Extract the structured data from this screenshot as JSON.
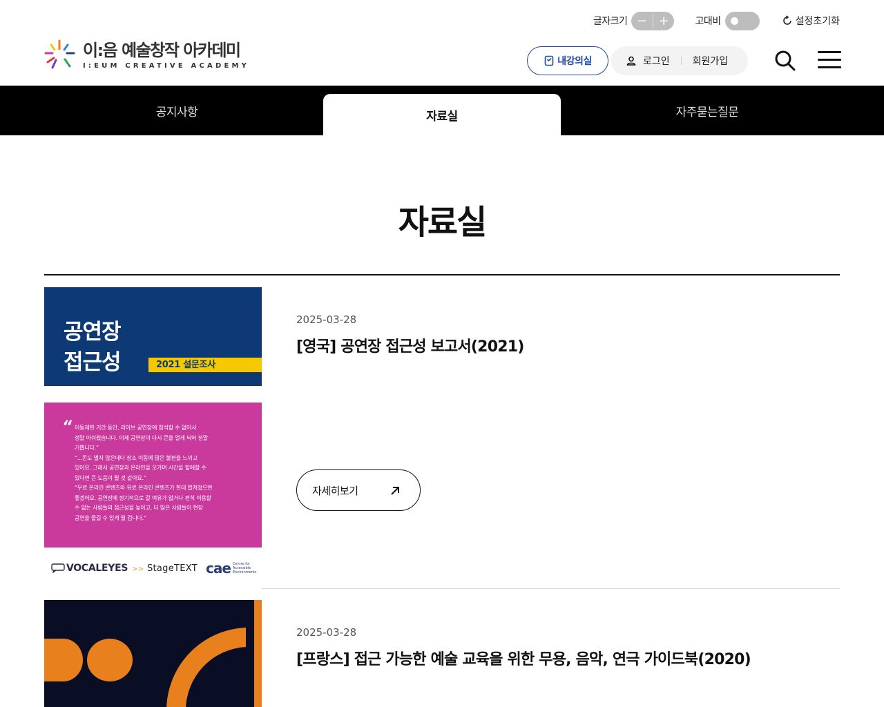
{
  "utility": {
    "font_size_label": "글자크기",
    "font_minus": "−",
    "font_plus": "+",
    "contrast_label": "고대비",
    "reset_label": "설정초기화"
  },
  "header": {
    "logo_ko": "이:음 예술창작 아카데미",
    "logo_en": "I:EUM CREATIVE ACADEMY",
    "my_class_label": "내강의실",
    "login_label": "로그인",
    "join_label": "회원가입"
  },
  "tabs": [
    {
      "label": "공지사항",
      "active": false
    },
    {
      "label": "자료실",
      "active": true
    },
    {
      "label": "자주묻는질문",
      "active": false
    }
  ],
  "page_title": "자료실",
  "items": [
    {
      "date": "2025-03-28",
      "title": "[영국] 공연장 접근성 보고서(2021)",
      "more_label": "자세히보기",
      "thumb": {
        "line1": "공연장",
        "line2": "접근성",
        "band": "2021 설문조사",
        "quote_mark": "“",
        "quote_lines": [
          "이동제한 기간 동안, 라이브 공연장에 참석할 수 없어서",
          "정말 아쉬웠습니다. 이제 공연장이 다시 문을 열게 되어 정말",
          "기쁩니다.”",
          "“...돈도 별지 않은데다 장소 이동에 많은 불편을 느끼고",
          "있어요. 그래서 공연장과 온라인을 오가며 시간을 할애할 수",
          "있다면 큰 도움이 될 것 같아요.”",
          "“무료 온라인 콘텐츠와 유료 온라인 콘텐츠가 한데 합쳐졌으면",
          "좋겠어요. 공연장에 정기적으로 갈 여유가 없거나 편히 이용할",
          "수 없는 사람들의 접근성을 높이고, 더 많은 사람들이 현장",
          "공연을 즐길 수 있게 될 겁니다.”"
        ],
        "logo_vocaleyes": "VOCALEYES",
        "logo_stagetext": "StageTEXT",
        "logo_stagetext_arrows": ">>",
        "logo_cae": "cae",
        "logo_cae_sub": "Centre for Accessible Environments"
      }
    },
    {
      "date": "2025-03-28",
      "title": "[프랑스] 접근 가능한 예술 교육을 위한 무용, 음악, 연극 가이드북(2020)"
    }
  ],
  "colors": {
    "tab_bar": "#000000",
    "accent_blue": "#1f4aa3",
    "cover_navy": "#0d3a74",
    "cover_yellow": "#f6c800",
    "cover_magenta": "#c93a9c",
    "cover2_orange": "#e8801e"
  },
  "icons": {
    "reset": "refresh-icon",
    "my_class": "book-icon",
    "login": "user-icon",
    "search": "search-icon",
    "menu": "hamburger-menu-icon",
    "more": "arrow-up-right-icon"
  }
}
